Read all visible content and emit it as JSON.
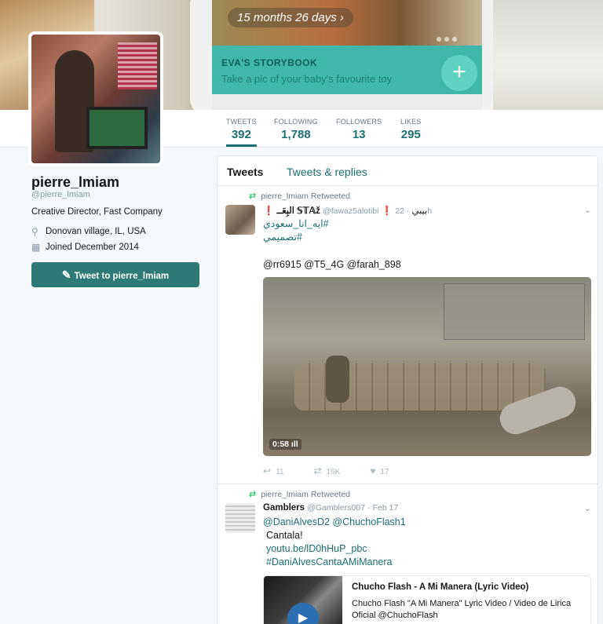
{
  "banner": {
    "months_label": "15 months 26 days",
    "storybook_title": "EVA'S STORYBOOK",
    "storybook_sub": "Take a pic of your baby's favourite toy",
    "plus_label": "+"
  },
  "stats": [
    {
      "label": "TWEETS",
      "value": "392"
    },
    {
      "label": "FOLLOWING",
      "value": "1,788"
    },
    {
      "label": "FOLLOWERS",
      "value": "13"
    },
    {
      "label": "LIKES",
      "value": "295"
    }
  ],
  "profile": {
    "name": "pierre_lmiam",
    "handle": "@pierre_lmiam",
    "bio": "Creative Director, Fast Company",
    "location": "Donovan village, IL, USA",
    "joined": "Joined December 2014",
    "tweet_to_label": "Tweet to pierre_lmiam"
  },
  "timeline": {
    "tabs": [
      {
        "label": "Tweets"
      },
      {
        "label": "Tweets & replies"
      }
    ],
    "tweets": [
      {
        "retweet_line": "pierre_lmiam Retweeted",
        "display_name": "❗ البِعَــ 𝕊𝕋𝔸ž",
        "handle": "@fawaz5alotibi",
        "extra": "❗ بيبي",
        "time": "· 22h",
        "lines": [
          "#ايه_انا_سعودي",
          "#تصميمي"
        ],
        "mentions": "@rr6915 @T5_4G @farah_898",
        "video_duration": "0:58",
        "reply_count": "11",
        "retweet_count": "16K",
        "like_count": "17"
      },
      {
        "retweet_line": "pierre_lmiam Retweeted",
        "display_name": "Gamblers",
        "handle": "@Gamblers007",
        "time": "· Feb 17",
        "lines": [
          "@DaniAlvesD2 @ChuchoFlash1",
          "Cantala!",
          "youtu.be/lD0hHuP_pbc",
          "#DaniAlvesCantaAMiManera"
        ],
        "card_title": "Chucho Flash - A Mi Manera (Lyric Video)",
        "card_desc": "Chucho Flash \"A Mi Manera\" Lyric Video / Video de Lirica Oficial @ChuchoFlash"
      }
    ]
  },
  "colors": {
    "accent": "#1c6e73",
    "button": "#2e7a78",
    "retweet_green": "#17bf63"
  }
}
